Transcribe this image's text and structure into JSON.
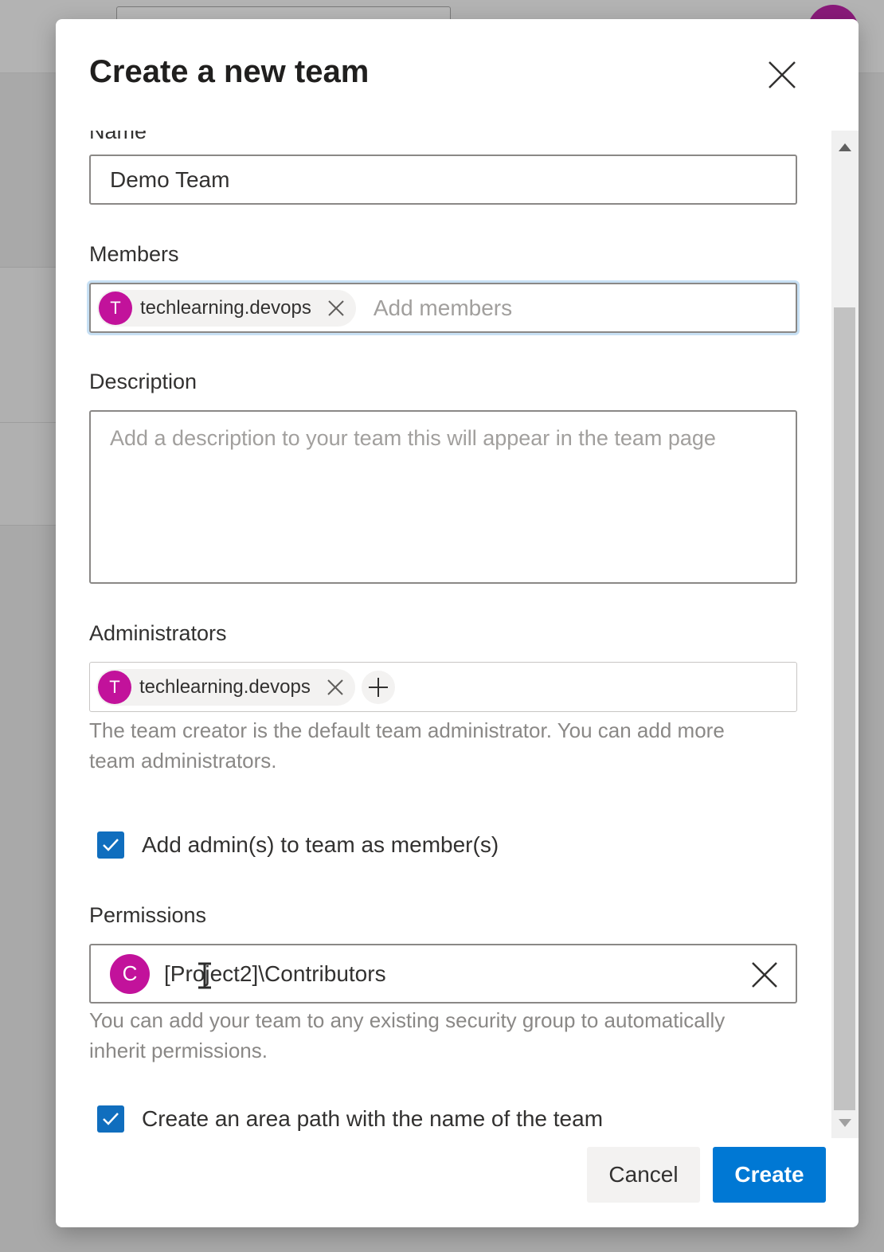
{
  "dialog": {
    "title": "Create a new team",
    "close_icon": "close-icon"
  },
  "name_field": {
    "label": "Name",
    "value": "Demo Team"
  },
  "members": {
    "label": "Members",
    "chips": [
      {
        "initial": "T",
        "name": "techlearning.devops"
      }
    ],
    "placeholder": "Add members"
  },
  "description": {
    "label": "Description",
    "placeholder": "Add a description to your team this will appear in the team page"
  },
  "administrators": {
    "label": "Administrators",
    "chips": [
      {
        "initial": "T",
        "name": "techlearning.devops"
      }
    ],
    "helper": "The team creator is the default team administrator. You can add more team administrators."
  },
  "add_admin_checkbox": {
    "label": "Add admin(s) to team as member(s)",
    "checked": true
  },
  "permissions": {
    "label": "Permissions",
    "group_initial": "C",
    "group_name": "[Project2]\\Contributors",
    "helper": "You can add your team to any existing security group to automatically inherit permissions."
  },
  "area_path_checkbox": {
    "label": "Create an area path with the name of the team",
    "checked": true
  },
  "footer": {
    "cancel_label": "Cancel",
    "create_label": "Create"
  },
  "colors": {
    "accent": "#0078d4",
    "avatar": "#c2129b",
    "checkbox": "#106ebe"
  }
}
